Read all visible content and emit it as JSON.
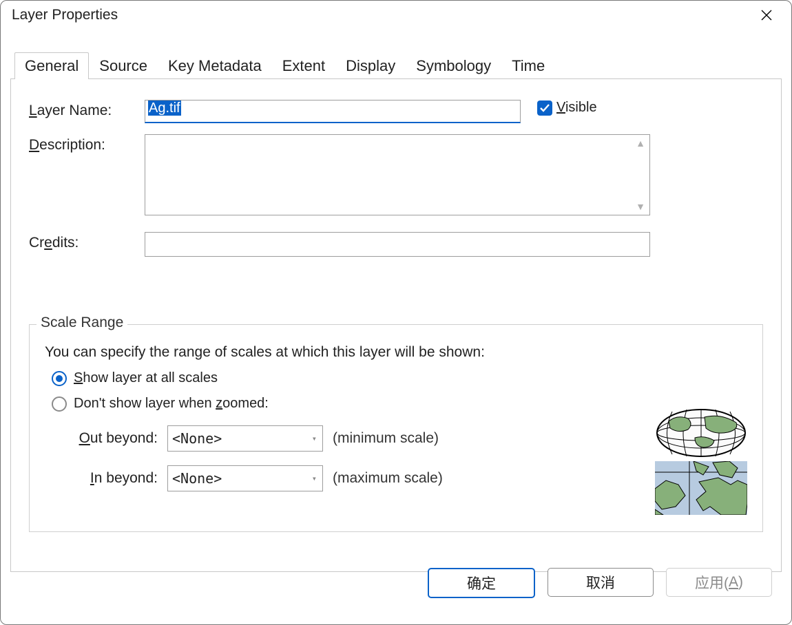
{
  "window": {
    "title": "Layer Properties"
  },
  "tabs": {
    "general": "General",
    "source": "Source",
    "key_metadata": "Key Metadata",
    "extent": "Extent",
    "display": "Display",
    "symbology": "Symbology",
    "time": "Time",
    "active": "general"
  },
  "general": {
    "layer_name_label_pre": "L",
    "layer_name_label_post": "ayer Name:",
    "layer_name_value": "Ag.tif",
    "visible_label_pre": "V",
    "visible_label_post": "isible",
    "visible_checked": true,
    "description_label_pre": "D",
    "description_label_post": "escription:",
    "description_value": "",
    "credits_label_pre": "Cr",
    "credits_label_mid": "e",
    "credits_label_post": "dits:",
    "credits_value": ""
  },
  "scale_range": {
    "legend": "Scale Range",
    "desc": "You can specify the range of scales at which this layer will be shown:",
    "radio_all_pre": "S",
    "radio_all_post": "how layer at all scales",
    "radio_all_selected": true,
    "radio_zoom_pre": "Don't show layer when ",
    "radio_zoom_mid": "z",
    "radio_zoom_post": "oomed:",
    "out_label_pre": "O",
    "out_label_post": "ut beyond:",
    "out_value": "<None>",
    "out_hint": "(minimum scale)",
    "in_label_pre": "I",
    "in_label_post": "n beyond:",
    "in_value": "<None>",
    "in_hint": "(maximum scale)"
  },
  "buttons": {
    "ok": "确定",
    "cancel": "取消",
    "apply_pre": "应用(",
    "apply_mid": "A",
    "apply_post": ")"
  }
}
